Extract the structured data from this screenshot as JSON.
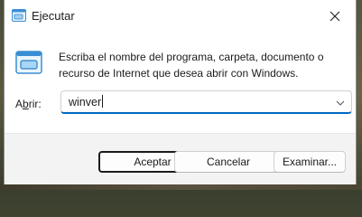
{
  "window": {
    "title": "Ejecutar",
    "icons": {
      "app": "run-app-icon",
      "close": "close-icon"
    }
  },
  "content": {
    "description": "Escriba el nombre del programa, carpeta, documento o recurso de Internet que desea abrir con Windows.",
    "open_label_prefix": "A",
    "open_label_underlined": "b",
    "open_label_suffix": "rir:",
    "combo_value": "winver",
    "combo_icon": "chevron-down-icon"
  },
  "buttons": {
    "accept_label": "Aceptar",
    "cancel_label": "Cancelar",
    "browse_label": "Examinar..."
  },
  "colors": {
    "accent": "#0067c0",
    "dialog_background": "#ffffff",
    "footer_background": "#f3f3f3"
  }
}
